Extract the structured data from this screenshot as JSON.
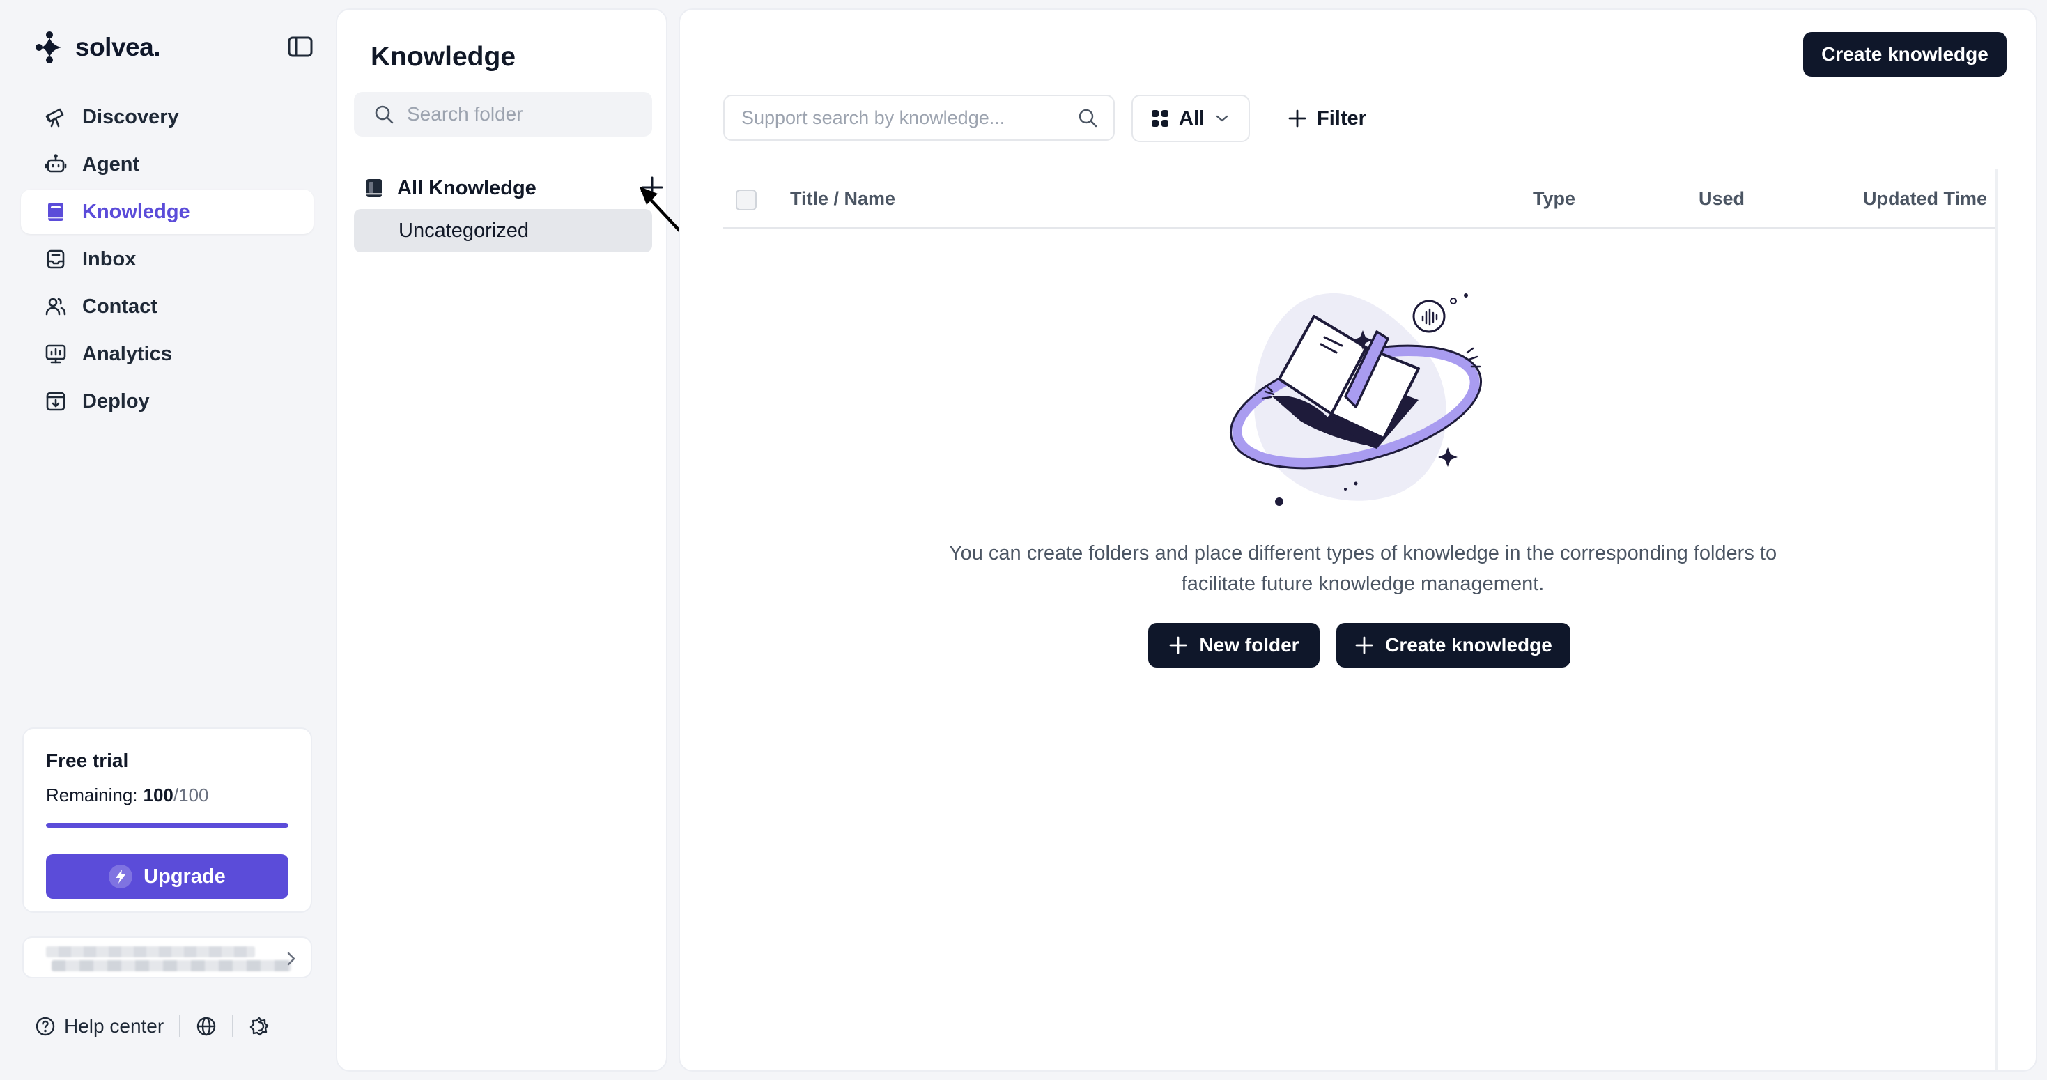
{
  "brand": {
    "name": "solvea.",
    "accent": "#5b4cd9",
    "dark": "#0f172a"
  },
  "nav": {
    "items": [
      {
        "label": "Discovery",
        "icon": "telescope-icon"
      },
      {
        "label": "Agent",
        "icon": "robot-icon"
      },
      {
        "label": "Knowledge",
        "icon": "book-icon",
        "active": true
      },
      {
        "label": "Inbox",
        "icon": "inbox-icon"
      },
      {
        "label": "Contact",
        "icon": "users-icon"
      },
      {
        "label": "Analytics",
        "icon": "chart-icon"
      },
      {
        "label": "Deploy",
        "icon": "deploy-icon"
      }
    ]
  },
  "trial": {
    "title": "Free trial",
    "remaining_label": "Remaining:",
    "remaining": "100",
    "total": "/100",
    "progress_fraction": 1.0,
    "upgrade_label": "Upgrade"
  },
  "footer": {
    "help_label": "Help center"
  },
  "folders": {
    "title": "Knowledge",
    "search_placeholder": "Search folder",
    "all_label": "All Knowledge",
    "items": [
      "Uncategorized"
    ]
  },
  "main": {
    "create_label": "Create knowledge",
    "search_placeholder": "Support search by knowledge...",
    "type_filter": "All",
    "filter_label": "Filter",
    "columns": [
      "Title / Name",
      "Type",
      "Used",
      "Updated Time"
    ],
    "empty_message": "You can create folders and place different types of knowledge in the corresponding folders to facilitate future knowledge management.",
    "new_folder_label": "New folder",
    "create_empty_label": "Create knowledge"
  }
}
